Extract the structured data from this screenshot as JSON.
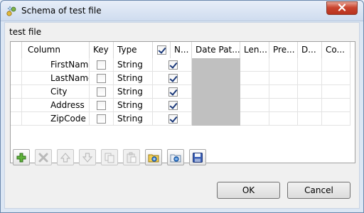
{
  "window": {
    "title": "Schema of test file",
    "close_icon": "close-icon",
    "app_icon": "schema-icon"
  },
  "subtitle": "test file",
  "table": {
    "headers": {
      "column": "Column",
      "key": "Key",
      "type": "Type",
      "nullable": "N...",
      "date_pattern": "Date Pat...",
      "length": "Len...",
      "precision": "Pre...",
      "default": "D...",
      "comment": "Co..."
    },
    "nullable_header_checked": true,
    "rows": [
      {
        "column": "FirstName",
        "key": false,
        "type": "String",
        "nullable": true,
        "date_pattern": "",
        "length": "",
        "precision": "",
        "default": "",
        "comment": ""
      },
      {
        "column": "LastName",
        "key": false,
        "type": "String",
        "nullable": true,
        "date_pattern": "",
        "length": "",
        "precision": "",
        "default": "",
        "comment": ""
      },
      {
        "column": "City",
        "key": false,
        "type": "String",
        "nullable": true,
        "date_pattern": "",
        "length": "",
        "precision": "",
        "default": "",
        "comment": ""
      },
      {
        "column": "Address",
        "key": false,
        "type": "String",
        "nullable": true,
        "date_pattern": "",
        "length": "",
        "precision": "",
        "default": "",
        "comment": ""
      },
      {
        "column": "ZipCode",
        "key": false,
        "type": "String",
        "nullable": true,
        "date_pattern": "",
        "length": "",
        "precision": "",
        "default": "",
        "comment": ""
      }
    ]
  },
  "toolbar": {
    "buttons": [
      {
        "name": "add-icon",
        "enabled": true
      },
      {
        "name": "delete-icon",
        "enabled": false
      },
      {
        "name": "move-up-icon",
        "enabled": false
      },
      {
        "name": "move-down-icon",
        "enabled": false
      },
      {
        "name": "copy-icon",
        "enabled": false
      },
      {
        "name": "paste-icon",
        "enabled": false
      },
      {
        "name": "import-schema-icon",
        "enabled": true
      },
      {
        "name": "export-schema-icon",
        "enabled": true
      },
      {
        "name": "save-icon",
        "enabled": true
      }
    ]
  },
  "buttons": {
    "ok": "OK",
    "cancel": "Cancel"
  }
}
